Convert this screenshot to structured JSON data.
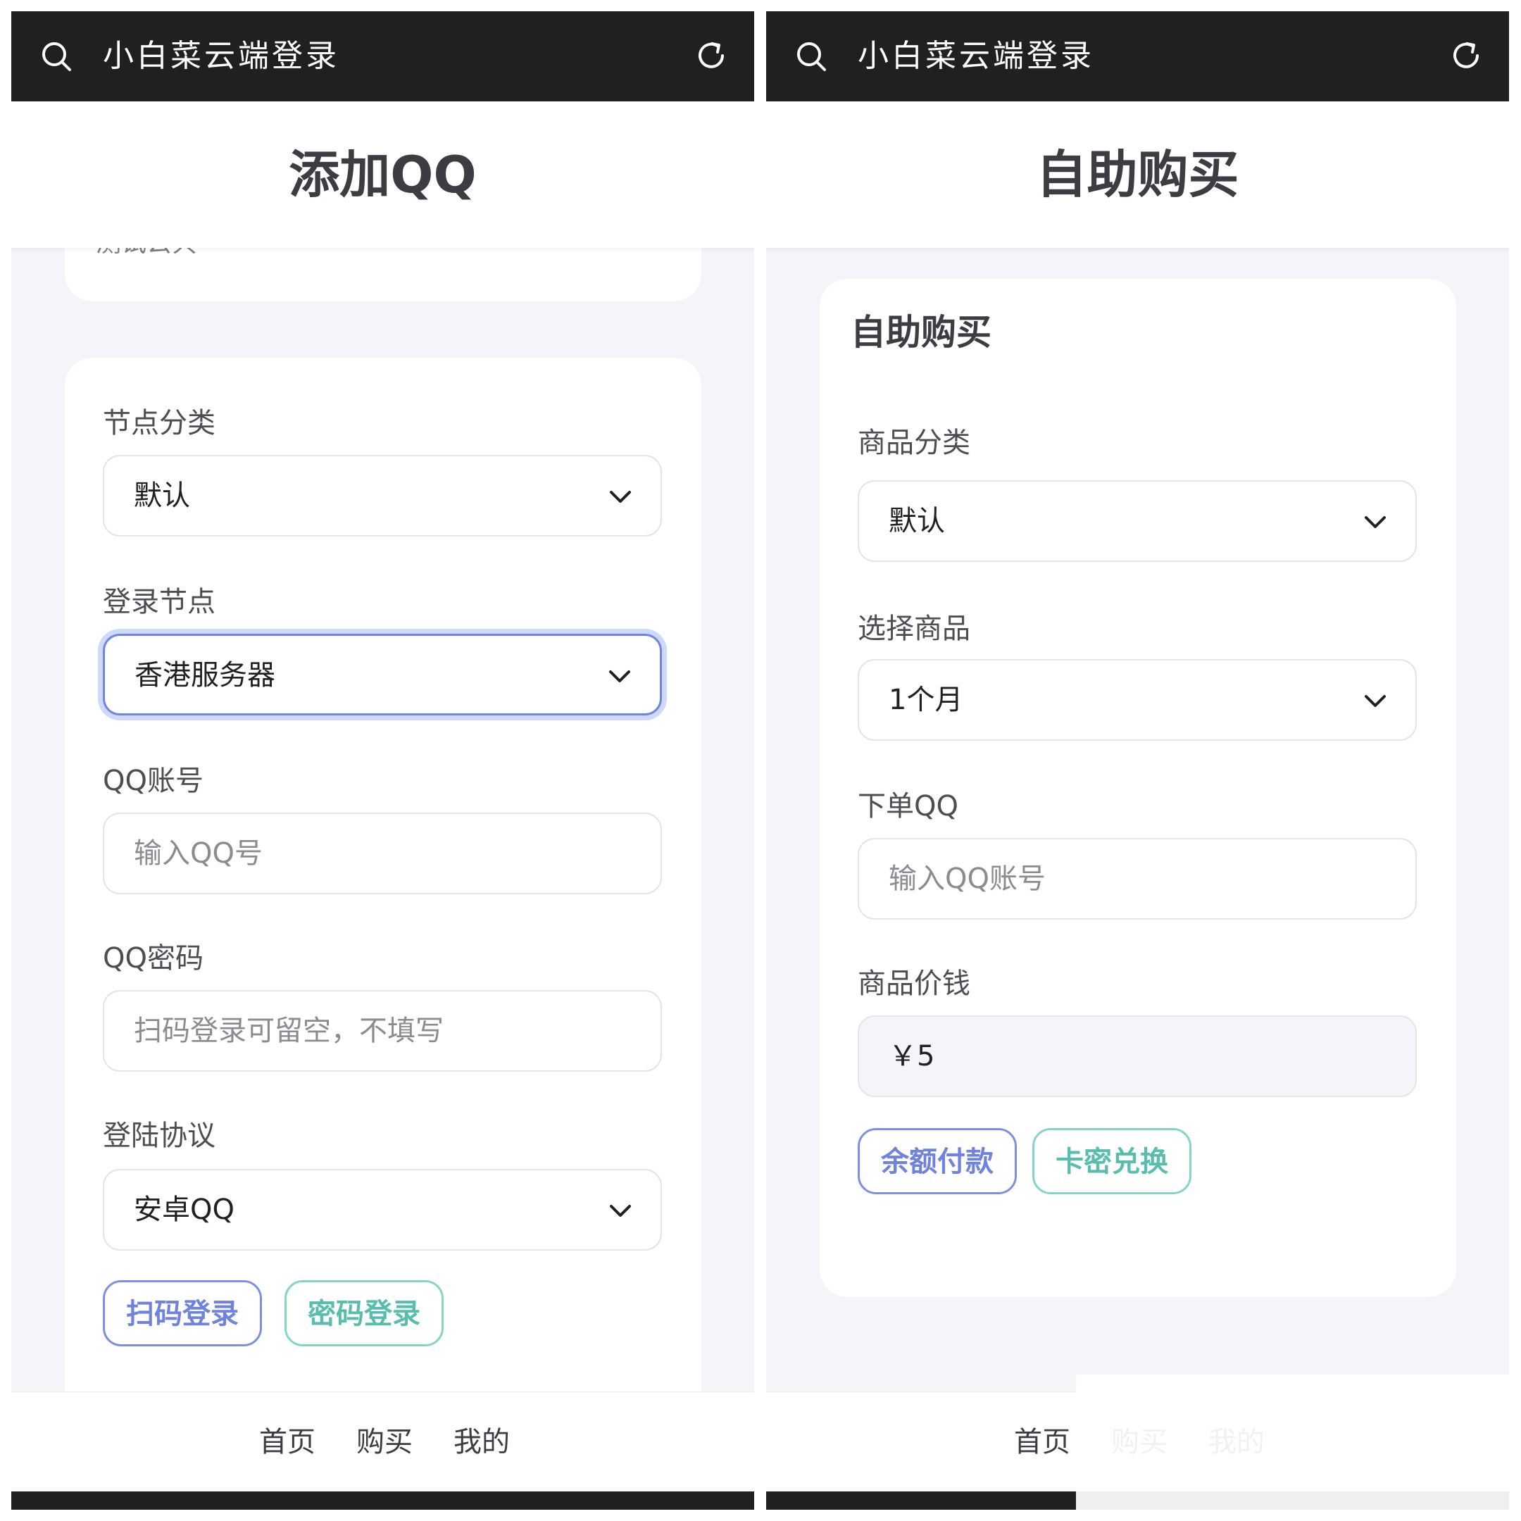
{
  "left": {
    "topbar": {
      "title": "小白菜云端登录"
    },
    "page_title": "添加QQ",
    "notice": {
      "text": "测试公共"
    },
    "form": {
      "node_category": {
        "label": "节点分类",
        "value": "默认"
      },
      "login_node": {
        "label": "登录节点",
        "value": "香港服务器"
      },
      "qq_account": {
        "label": "QQ账号",
        "placeholder": "输入QQ号"
      },
      "qq_password": {
        "label": "QQ密码",
        "placeholder": "扫码登录可留空，不填写"
      },
      "login_protocol": {
        "label": "登陆协议",
        "value": "安卓QQ"
      },
      "scan_login_label": "扫码登录",
      "password_login_label": "密码登录"
    },
    "nav": {
      "home": "首页",
      "buy": "购买",
      "mine": "我的"
    }
  },
  "right": {
    "topbar": {
      "title": "小白菜云端登录"
    },
    "page_title": "自助购买",
    "card_title": "自助购买",
    "form": {
      "product_category": {
        "label": "商品分类",
        "value": "默认"
      },
      "select_product": {
        "label": "选择商品",
        "value": "1个月"
      },
      "order_qq": {
        "label": "下单QQ",
        "placeholder": "输入QQ账号"
      },
      "product_price": {
        "label": "商品价钱",
        "value": "￥5"
      },
      "balance_pay_label": "余额付款",
      "card_redeem_label": "卡密兑换"
    },
    "nav": {
      "home": "首页",
      "buy": "购买",
      "mine": "我的"
    }
  },
  "colors": {
    "topbar": "#1e2022",
    "page_bg": "#f4f5f9",
    "accent_blue": "#6f82dc",
    "accent_teal": "#58bdac",
    "focus_ring": "#cfd9fb"
  },
  "icons": [
    "search-icon",
    "refresh-icon",
    "chevron-down-icon"
  ]
}
